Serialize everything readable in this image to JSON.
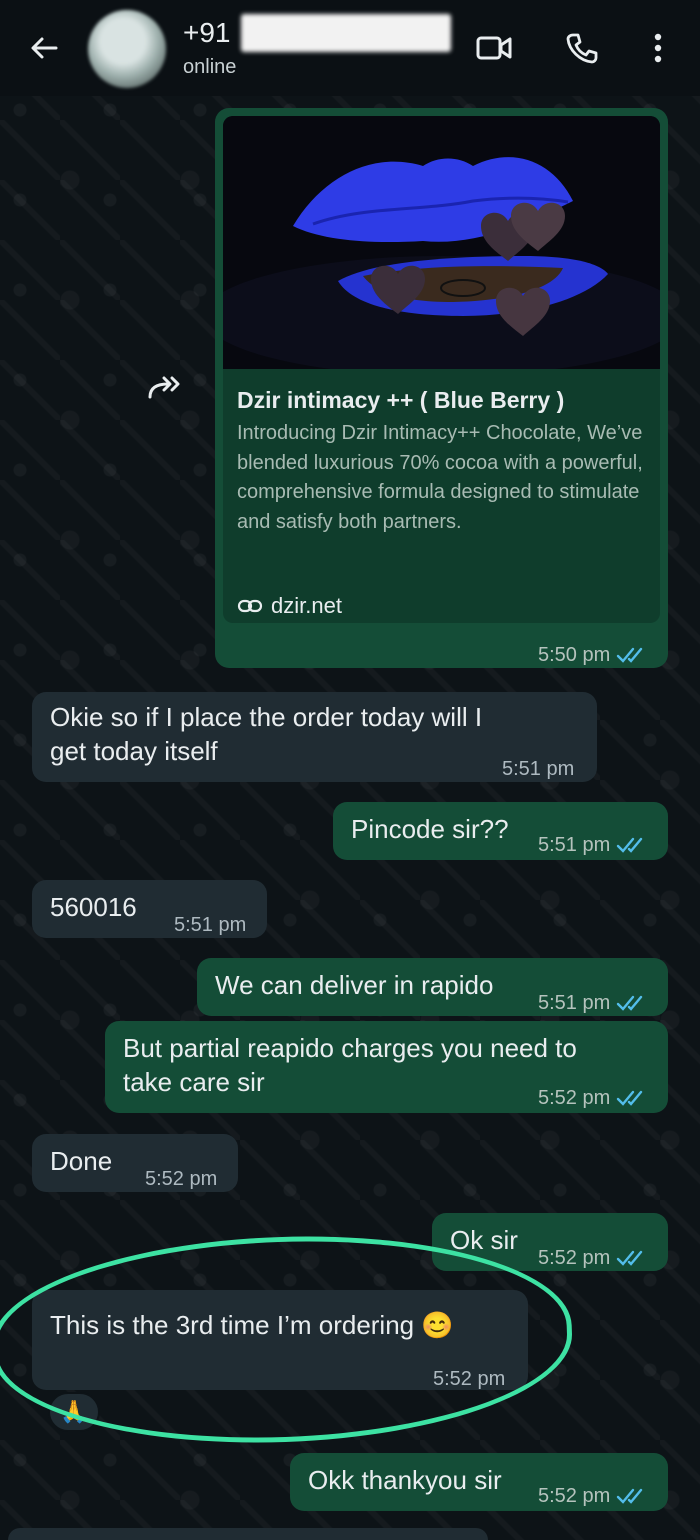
{
  "header": {
    "contact_prefix": "+91",
    "status": "online"
  },
  "link_preview": {
    "title": "Dzir intimacy ++ ( Blue Berry )",
    "description": "Introducing Dzir Intimacy++ Chocolate, We’ve blended luxurious 70% cocoa with a powerful, comprehensive formula designed to stimulate and satisfy both partners.",
    "link": "dzir.net",
    "time": "5:50 pm"
  },
  "messages": [
    {
      "id": "m1",
      "direction": "in",
      "lines": [
        "Okie so if I place the order today will I",
        "get today itself"
      ],
      "time": "5:51 pm"
    },
    {
      "id": "m2",
      "direction": "out",
      "lines": [
        "Pincode sir??"
      ],
      "time": "5:51 pm"
    },
    {
      "id": "m3",
      "direction": "in",
      "lines": [
        "560016"
      ],
      "time": "5:51 pm"
    },
    {
      "id": "m4",
      "direction": "out",
      "lines": [
        "We can deliver in rapido"
      ],
      "time": "5:51 pm"
    },
    {
      "id": "m5",
      "direction": "out",
      "lines": [
        "But partial reapido charges you need to",
        "take care sir"
      ],
      "time": "5:52 pm"
    },
    {
      "id": "m6",
      "direction": "in",
      "lines": [
        "Done"
      ],
      "time": "5:52 pm"
    },
    {
      "id": "m7",
      "direction": "out",
      "lines": [
        "Ok sir"
      ],
      "time": "5:52 pm"
    },
    {
      "id": "m8",
      "direction": "in",
      "lines": [
        "This is the 3rd time I’m ordering 😊"
      ],
      "time": "5:52 pm",
      "reaction": "🙏"
    },
    {
      "id": "m9",
      "direction": "out",
      "lines": [
        "Okk thankyou sir"
      ],
      "time": "5:52 pm"
    }
  ],
  "colors": {
    "outgoing_bubble": "#144d37",
    "incoming_bubble": "#202c33",
    "read_ticks": "#53bdeb",
    "highlight_circle": "#3de2a3"
  },
  "icons": [
    "back-arrow-icon",
    "video-call-icon",
    "phone-icon",
    "more-vert-icon",
    "forward-icon",
    "link-icon",
    "double-check-icon"
  ]
}
